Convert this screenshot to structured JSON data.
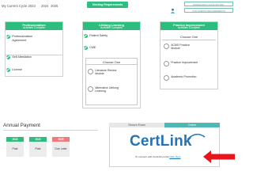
{
  "header": {
    "cycle_label": "My Current Cycle 2023",
    "years": [
      "2024",
      "2025"
    ],
    "meeting_button": "Meeting Requirements",
    "action_buttons": [
      "DOWNLOAD CYCLE HISTORY",
      "OUR #CERTIL REQUIREMENTS"
    ],
    "icon": "user-sync-icon"
  },
  "cards": [
    {
      "title": "Professionalism",
      "subtitle": "Activities Complete",
      "items": [
        "Professionalism Agreement",
        "Self Attestation",
        "License"
      ]
    },
    {
      "title": "Lifelong Learning",
      "subtitle": "Activities Complete",
      "items": [
        "Patient Safety",
        "CME"
      ],
      "choose_title": "Choose One",
      "choose_items": [
        "Literature Review Module",
        "Alternative Lifelong Learning"
      ]
    },
    {
      "title": "Practice Improvement",
      "subtitle": "Activities Complete",
      "choose_title": "Choose One",
      "choose_items": [
        "ACMS Practice Module",
        "Practice Improvement",
        "Academic Promotion"
      ]
    }
  ],
  "payment": {
    "title": "Annual Payment",
    "years": [
      {
        "year": "2023",
        "status": "Paid",
        "color": "#2dbd7e"
      },
      {
        "year": "2024",
        "status": "Paid",
        "color": "#2dbd7e"
      },
      {
        "year": "2025",
        "status": "Due Later",
        "color": "#f27a7a"
      }
    ]
  },
  "exam": {
    "tabs": [
      "Secure Exam",
      "Online"
    ],
    "logo_text": "CertLink",
    "connect_text": "To connect with CertLink portal",
    "link_text": "Click Here"
  },
  "colors": {
    "accent": "#2dbd7e",
    "due": "#f27a7a",
    "arrow": "#e8141b",
    "logo": "#2473b6"
  }
}
